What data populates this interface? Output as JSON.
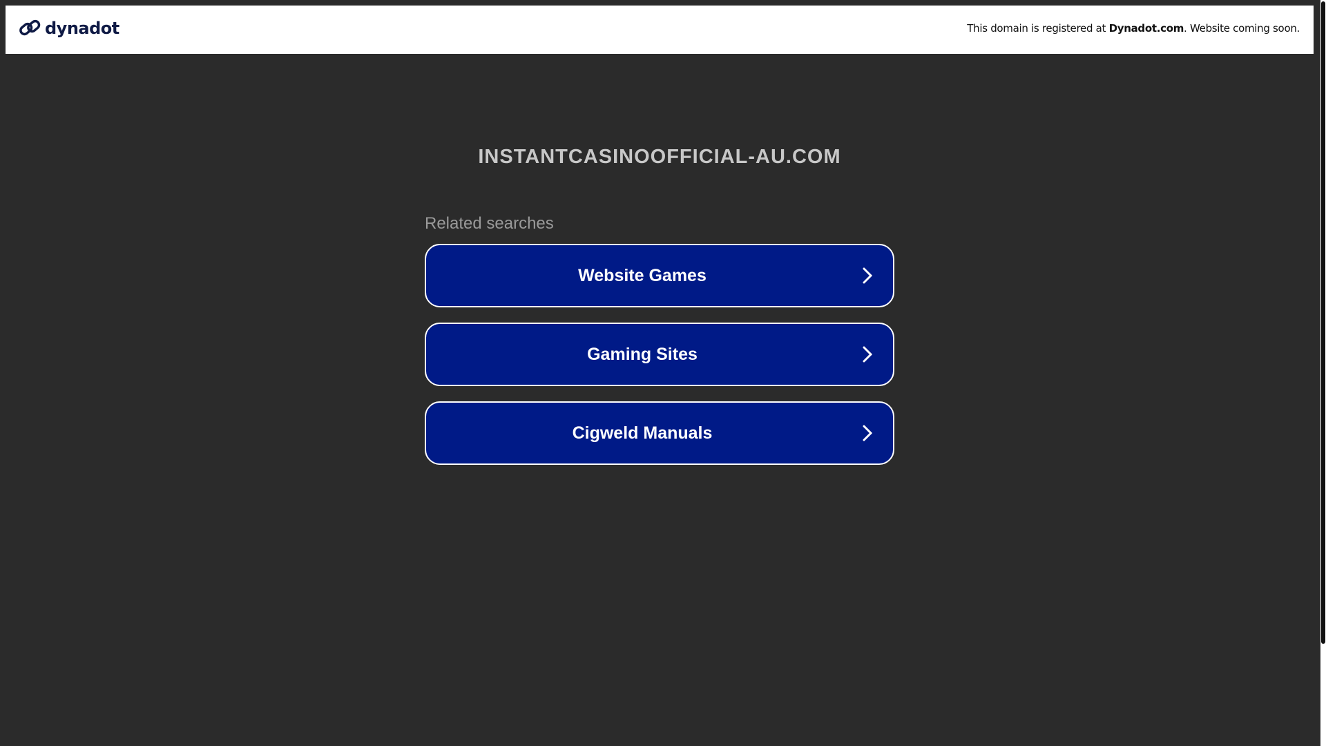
{
  "header": {
    "logo_text": "dynadot",
    "notice_prefix": "This domain is registered at ",
    "notice_brand": "Dynadot.com",
    "notice_suffix": ". Website coming soon."
  },
  "main": {
    "domain_title": "INSTANTCASINOOFFICIAL-AU.COM",
    "related_label": "Related searches",
    "searches": [
      {
        "label": "Website Games"
      },
      {
        "label": "Gaming Sites"
      },
      {
        "label": "Cigweld Manuals"
      }
    ]
  },
  "colors": {
    "button_bg": "#001a87",
    "page_bg": "#2b2b2b"
  }
}
